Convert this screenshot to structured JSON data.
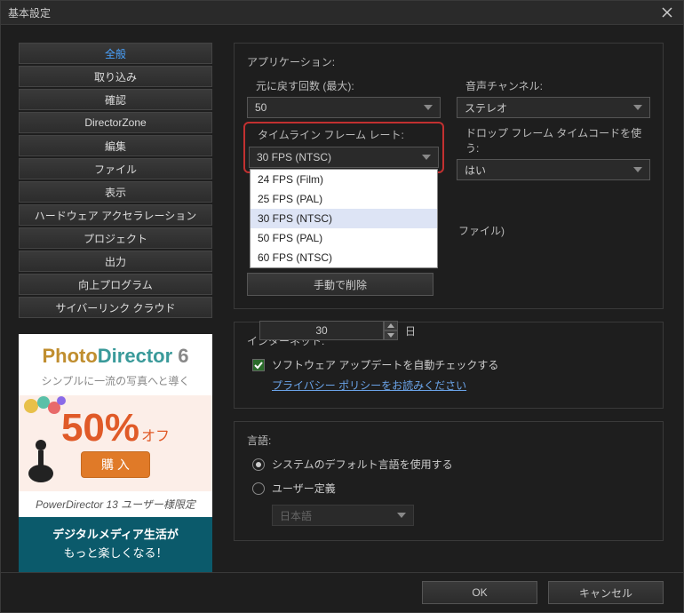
{
  "window": {
    "title": "基本設定"
  },
  "sidebar": {
    "items": [
      "全般",
      "取り込み",
      "確認",
      "DirectorZone",
      "編集",
      "ファイル",
      "表示",
      "ハードウェア アクセラレーション",
      "プロジェクト",
      "出力",
      "向上プログラム",
      "サイバーリンク クラウド"
    ]
  },
  "promo": {
    "logo_a": "Photo",
    "logo_b": "Director",
    "logo_c": " 6",
    "subtitle": "シンプルに一流の写真へと導く",
    "discount": "50%",
    "off": "オフ",
    "buy": "購 入",
    "pd_line": "PowerDirector 13 ユーザー様限定",
    "banner_l1": "デジタルメディア生活が",
    "banner_l2": "もっと楽しくなる！"
  },
  "app_section": {
    "title": "アプリケーション:",
    "undo_label": "元に戻す回数 (最大):",
    "undo_value": "50",
    "audio_label": "音声チャンネル:",
    "audio_value": "ステレオ",
    "fps_label": "タイムライン フレーム レート:",
    "fps_value": "30 FPS (NTSC)",
    "fps_options": [
      "24 FPS (Film)",
      "25 FPS (PAL)",
      "30 FPS (NTSC)",
      "50 FPS (PAL)",
      "60 FPS (NTSC)"
    ],
    "drop_label": "ドロップ フレーム タイムコードを使う:",
    "drop_value": "はい",
    "hidden_label_hint": "ファイル)",
    "days_value": "30",
    "days_suffix": "日",
    "manual_delete": "手動で削除"
  },
  "internet_section": {
    "title": "インターネット:",
    "check_label": "ソフトウェア アップデートを自動チェックする",
    "privacy_link": "プライバシー ポリシーをお読みください"
  },
  "lang_section": {
    "title": "言語:",
    "opt_system": "システムのデフォルト言語を使用する",
    "opt_user": "ユーザー定義",
    "lang_value": "日本語"
  },
  "footer": {
    "ok": "OK",
    "cancel": "キャンセル"
  }
}
